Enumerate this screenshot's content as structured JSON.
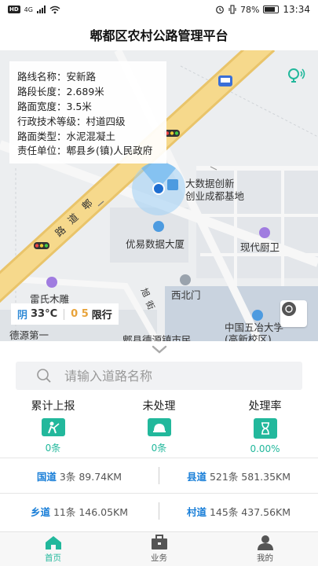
{
  "status_bar": {
    "hd": "HD",
    "network": "4G",
    "battery": "78%",
    "time": "13:34"
  },
  "header": {
    "title": "郫都区农村公路管理平台"
  },
  "info_card": {
    "route_name": "路线名称：安新路",
    "segment_length": "路段长度：2.689米",
    "road_width": "路面宽度：3.5米",
    "admin_grade": "行政技术等级：村道四级",
    "surface_type": "路面类型：水泥混凝土",
    "responsible": "责任单位：郫县乡(镇)人民政府"
  },
  "map_labels": {
    "big_data": "大数据创新\n创业成都基地",
    "youyi": "优易数据大厦",
    "xianxing": "现代厨卫",
    "leishi": "雷氏木雕",
    "xibeimen": "西北门",
    "zhongye": "中国五冶大学\n(高新校区)",
    "deyuan": "德源第一",
    "pixian_zhen": "郫县德源镇市民",
    "pi_road": "郫",
    "dao_road": "道",
    "lu_road": "路",
    "xu_street": "旭",
    "jie_street": "街"
  },
  "weather": {
    "condition": "阴",
    "temperature": "33°C",
    "limit_numbers": "0 5",
    "limit_label": "限行"
  },
  "search": {
    "placeholder": "请输入道路名称"
  },
  "stats": [
    {
      "label": "累计上报",
      "value": "0条",
      "icon": "worker-icon"
    },
    {
      "label": "未处理",
      "value": "0条",
      "icon": "helmet-icon"
    },
    {
      "label": "处理率",
      "value": "0.00%",
      "icon": "hourglass-icon"
    }
  ],
  "roads": [
    {
      "name": "国道",
      "detail": "3条 89.74KM"
    },
    {
      "name": "县道",
      "detail": "521条 581.35KM"
    },
    {
      "name": "乡道",
      "detail": "11条 146.05KM"
    },
    {
      "name": "村道",
      "detail": "145条 437.56KM"
    }
  ],
  "nav": [
    {
      "label": "首页",
      "icon": "home-icon",
      "active": true
    },
    {
      "label": "业务",
      "icon": "briefcase-icon",
      "active": false
    },
    {
      "label": "我的",
      "icon": "user-icon",
      "active": false
    }
  ],
  "colors": {
    "accent": "#22b89c",
    "road_name": "#1a7fd8",
    "road_main": "#f3c96a",
    "weather_blue": "#2f8ad6",
    "limit_orange": "#e8a33a"
  }
}
